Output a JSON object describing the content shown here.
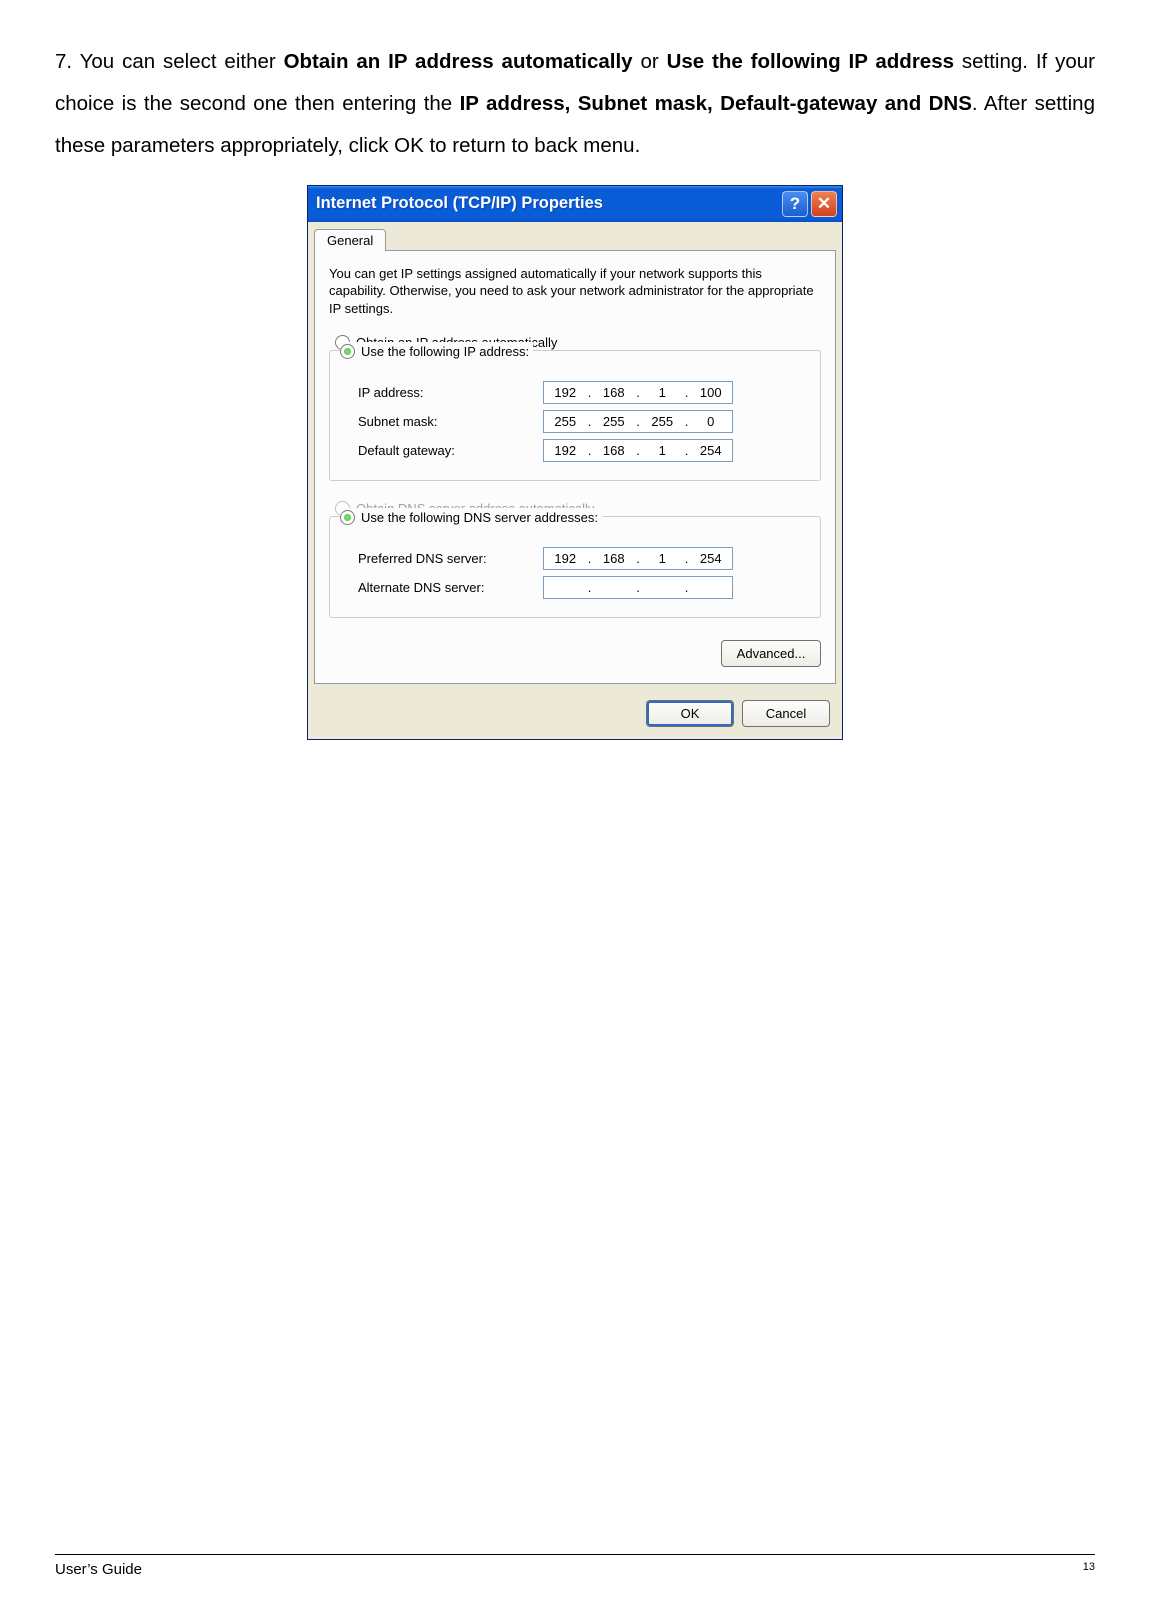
{
  "instruction": {
    "prefix": "7. You can select either ",
    "opt1": "Obtain an IP address automatically",
    "mid1": " or ",
    "opt2": "Use the following IP address",
    "mid2": " setting. If your choice is the second one then entering the ",
    "fields": "IP address, Subnet mask, Default-gateway and DNS",
    "suffix": ". After setting these parameters appropriately, click OK to return to back menu."
  },
  "dialog": {
    "title": "Internet Protocol (TCP/IP) Properties",
    "help_symbol": "?",
    "close_symbol": "✕",
    "tab": "General",
    "intro": "You can get IP settings assigned automatically if your network supports this capability. Otherwise, you need to ask your network administrator for the appropriate IP settings.",
    "radio_auto_ip": "Obtain an IP address automatically",
    "radio_use_ip": "Use the following IP address:",
    "ip_label": "IP address:",
    "ip_value": [
      "192",
      "168",
      "1",
      "100"
    ],
    "subnet_label": "Subnet mask:",
    "subnet_value": [
      "255",
      "255",
      "255",
      "0"
    ],
    "gateway_label": "Default gateway:",
    "gateway_value": [
      "192",
      "168",
      "1",
      "254"
    ],
    "radio_auto_dns": "Obtain DNS server address automatically",
    "radio_use_dns": "Use the following DNS server addresses:",
    "pref_dns_label": "Preferred DNS server:",
    "pref_dns_value": [
      "192",
      "168",
      "1",
      "254"
    ],
    "alt_dns_label": "Alternate DNS server:",
    "alt_dns_value": [
      "",
      "",
      "",
      ""
    ],
    "advanced": "Advanced...",
    "ok": "OK",
    "cancel": "Cancel"
  },
  "footer": {
    "left": "User’s Guide",
    "right": "13"
  }
}
